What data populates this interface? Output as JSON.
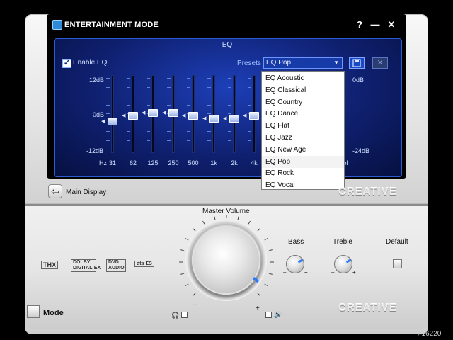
{
  "window": {
    "title": "ENTERTAINMENT MODE",
    "help_glyph": "?",
    "minimize_glyph": "—",
    "close_glyph": "✕"
  },
  "eq": {
    "header": "EQ",
    "enable_label": "Enable EQ",
    "enable_checked": true,
    "presets_label": "Presets",
    "selected_preset": "EQ Pop",
    "db_top": "12dB",
    "db_mid": "0dB",
    "db_bottom": "-12dB",
    "db_right_top": "0dB",
    "db_right_bottom": "-24dB",
    "hz_label": "Hz",
    "level_label": "Level",
    "bands": [
      {
        "freq": "31",
        "gain_db": -2
      },
      {
        "freq": "62",
        "gain_db": 0
      },
      {
        "freq": "125",
        "gain_db": 1
      },
      {
        "freq": "250",
        "gain_db": 1
      },
      {
        "freq": "500",
        "gain_db": 0
      },
      {
        "freq": "1k",
        "gain_db": -1
      },
      {
        "freq": "2k",
        "gain_db": -1
      },
      {
        "freq": "4k",
        "gain_db": 0
      }
    ],
    "preset_options": [
      "EQ Acoustic",
      "EQ Classical",
      "EQ Country",
      "EQ Dance",
      "EQ Flat",
      "EQ Jazz",
      "EQ New Age",
      "EQ Pop",
      "EQ Rock",
      "EQ Vocal"
    ]
  },
  "nav": {
    "main_display_label": "Main Display"
  },
  "brand": {
    "logo_text": "CREATIVE"
  },
  "controls": {
    "master_volume_label": "Master Volume",
    "bass_label": "Bass",
    "treble_label": "Treble",
    "default_label": "Default",
    "mode_label": "Mode",
    "minus_sign": "–",
    "plus_sign": "+",
    "accent_color": "#2a78ff"
  },
  "logos": {
    "thx": "THX",
    "dolby": "DOLBY DIGITAL·EX",
    "dvd": "DVD AUDIO",
    "dts": "dts ES"
  },
  "watermark": "#16220"
}
